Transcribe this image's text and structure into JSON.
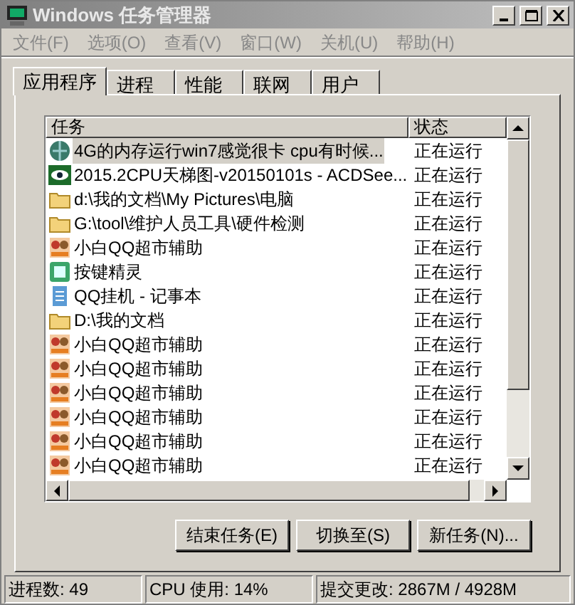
{
  "window": {
    "title": "Windows 任务管理器"
  },
  "menu": [
    "文件(F)",
    "选项(O)",
    "查看(V)",
    "窗口(W)",
    "关机(U)",
    "帮助(H)"
  ],
  "tabs": [
    {
      "label": "应用程序",
      "selected": true
    },
    {
      "label": "进程",
      "selected": false
    },
    {
      "label": "性能",
      "selected": false
    },
    {
      "label": "联网",
      "selected": false
    },
    {
      "label": "用户",
      "selected": false
    }
  ],
  "table": {
    "columns": [
      "任务",
      "状态"
    ],
    "rows": [
      {
        "kind": "browser",
        "task": "4G的内存运行win7感觉很卡 cpu有时候...",
        "status": "正在运行",
        "selected": true
      },
      {
        "kind": "viewer",
        "task": "2015.2CPU天梯图-v20150101s - ACDSee...",
        "status": "正在运行",
        "selected": false
      },
      {
        "kind": "folder",
        "task": "d:\\我的文档\\My Pictures\\电脑",
        "status": "正在运行",
        "selected": false
      },
      {
        "kind": "folder",
        "task": "G:\\tool\\维护人员工具\\硬件检测",
        "status": "正在运行",
        "selected": false
      },
      {
        "kind": "app",
        "task": "小白QQ超市辅助",
        "status": "正在运行",
        "selected": false
      },
      {
        "kind": "keys",
        "task": "按键精灵",
        "status": "正在运行",
        "selected": false
      },
      {
        "kind": "notepad",
        "task": "QQ挂机 - 记事本",
        "status": "正在运行",
        "selected": false
      },
      {
        "kind": "folder",
        "task": "D:\\我的文档",
        "status": "正在运行",
        "selected": false
      },
      {
        "kind": "app",
        "task": "小白QQ超市辅助",
        "status": "正在运行",
        "selected": false
      },
      {
        "kind": "app",
        "task": "小白QQ超市辅助",
        "status": "正在运行",
        "selected": false
      },
      {
        "kind": "app",
        "task": "小白QQ超市辅助",
        "status": "正在运行",
        "selected": false
      },
      {
        "kind": "app",
        "task": "小白QQ超市辅助",
        "status": "正在运行",
        "selected": false
      },
      {
        "kind": "app",
        "task": "小白QQ超市辅助",
        "status": "正在运行",
        "selected": false
      },
      {
        "kind": "app",
        "task": "小白QQ超市辅助",
        "status": "正在运行",
        "selected": false
      }
    ]
  },
  "buttons": [
    "结束任务(E)",
    "切换至(S)",
    "新任务(N)..."
  ],
  "status_bar": [
    "进程数: 49",
    "CPU 使用: 14%",
    "提交更改: 2867M / 4928M"
  ]
}
